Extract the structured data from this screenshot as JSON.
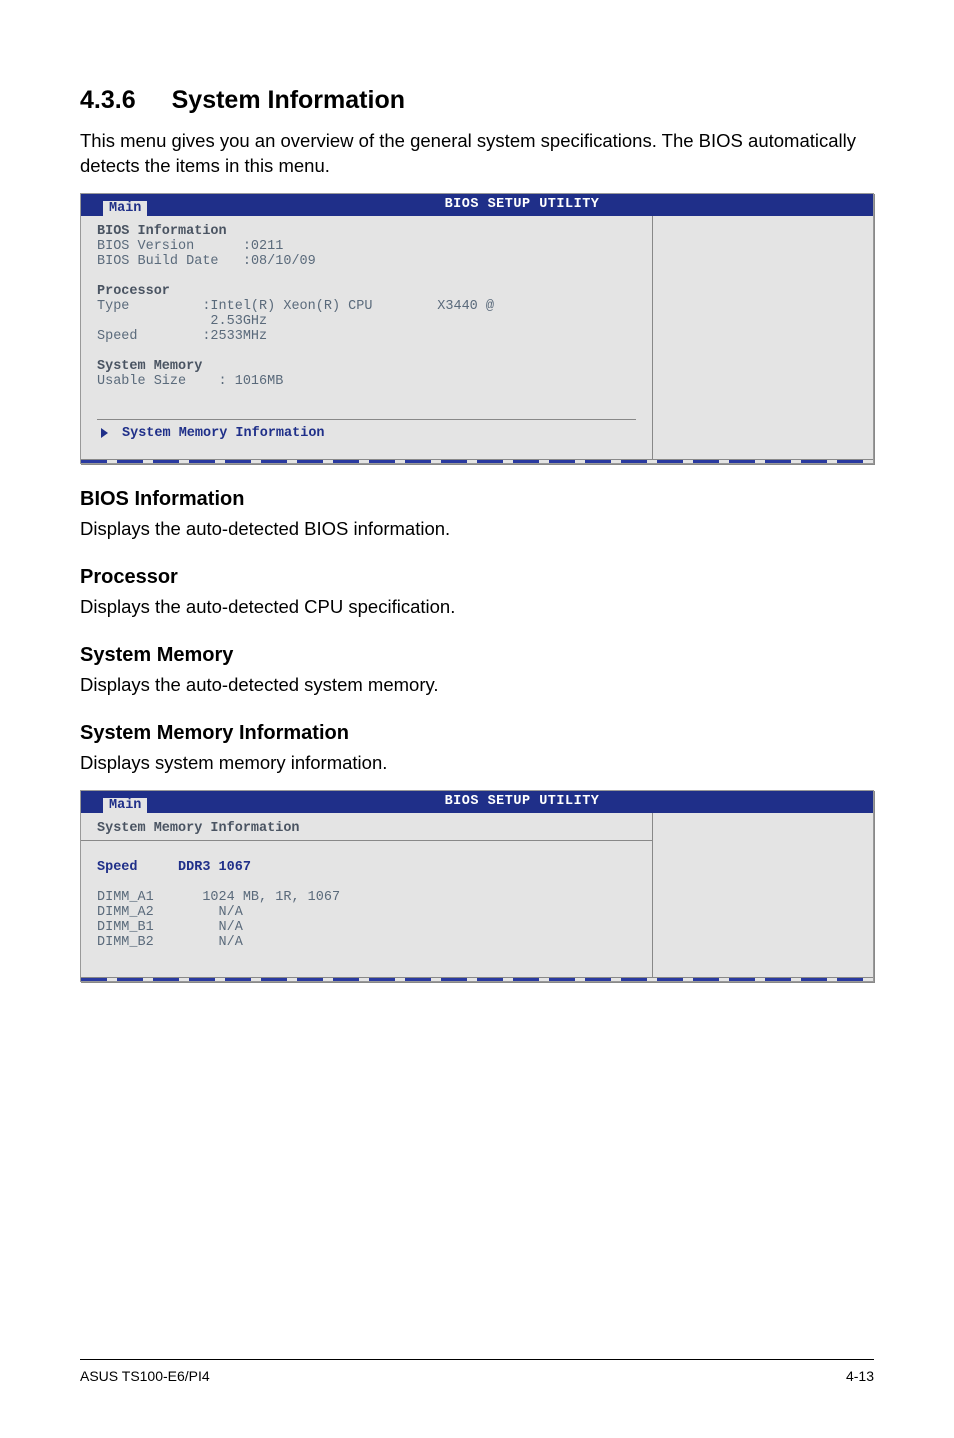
{
  "section": {
    "number": "4.3.6",
    "title": "System Information",
    "intro": "This menu gives you an overview of the general system specifications. The BIOS automatically detects the items in this menu."
  },
  "bios_panel_1": {
    "header_title": "BIOS SETUP UTILITY",
    "tab": "Main",
    "info_heading": "BIOS Information",
    "bios_version_label": "BIOS Version",
    "bios_version_value": ":0211",
    "bios_build_label": "BIOS Build Date",
    "bios_build_value": ":08/10/09",
    "processor_heading": "Processor",
    "type_label": "Type",
    "type_value": ":Intel(R) Xeon(R) CPU        X3440 @\n              2.53GHz",
    "speed_label": "Speed",
    "speed_value": ":2533MHz",
    "sysmem_heading": "System Memory",
    "usable_label": "Usable Size",
    "usable_value": ": 1016MB",
    "submenu": "System Memory Information"
  },
  "subsections": {
    "bios_info_h": "BIOS Information",
    "bios_info_p": "Displays the auto-detected BIOS information.",
    "proc_h": "Processor",
    "proc_p": "Displays the auto-detected CPU specification.",
    "sysmem_h": "System Memory",
    "sysmem_p": "Displays the auto-detected system memory.",
    "smi_h": "System Memory Information",
    "smi_p": "Displays system memory information."
  },
  "bios_panel_2": {
    "header_title": "BIOS SETUP UTILITY",
    "tab": "Main",
    "heading": "System Memory Information",
    "speed_label": "Speed",
    "speed_value": "DDR3 1067",
    "dimms": [
      {
        "slot": "DIMM_A1",
        "value": "1024 MB, 1R, 1067"
      },
      {
        "slot": "DIMM_A2",
        "value": "  N/A"
      },
      {
        "slot": "DIMM_B1",
        "value": "  N/A"
      },
      {
        "slot": "DIMM_B2",
        "value": "  N/A"
      }
    ]
  },
  "footer": {
    "left": "ASUS TS100-E6/PI4",
    "right": "4-13"
  }
}
